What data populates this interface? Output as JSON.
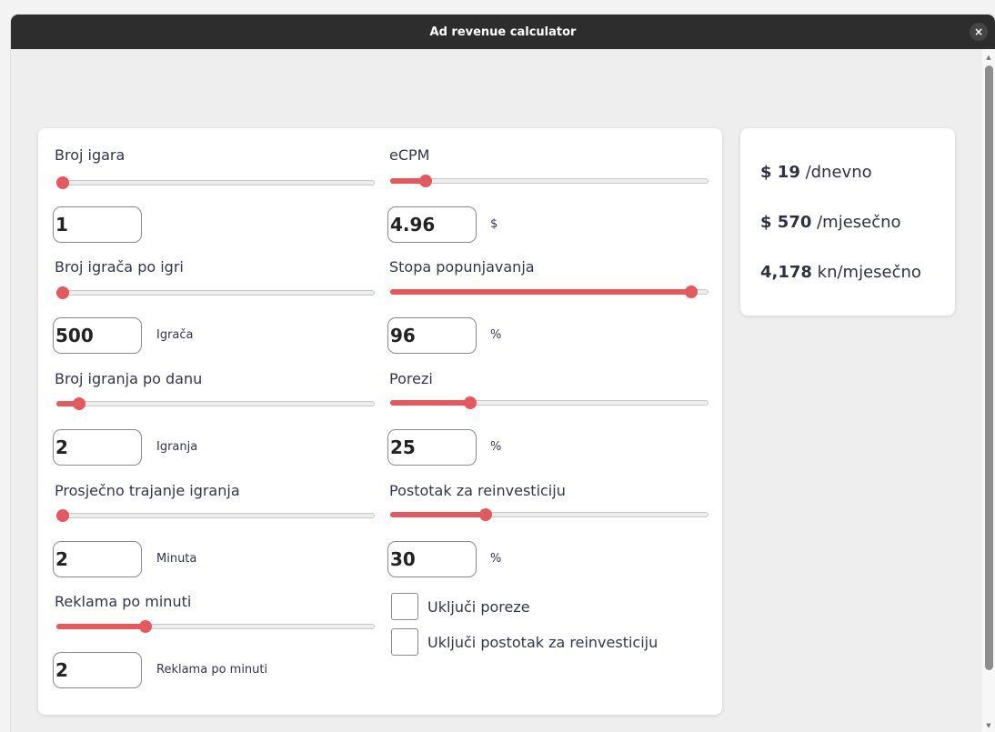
{
  "window": {
    "title": "Ad revenue calculator",
    "close_glyph": "×"
  },
  "fields": {
    "broj_igara": {
      "label": "Broj igara",
      "value": "1",
      "unit": "",
      "slider_fraction": 0.02
    },
    "broj_igraca": {
      "label": "Broj igrača po igri",
      "value": "500",
      "unit": "Igrača",
      "slider_fraction": 0.02
    },
    "broj_igranja": {
      "label": "Broj igranja po danu",
      "value": "2",
      "unit": "Igranja",
      "slider_fraction": 0.07
    },
    "trajanje": {
      "label": "Prosječno trajanje igranja",
      "value": "2",
      "unit": "Minuta",
      "slider_fraction": 0.02
    },
    "reklama": {
      "label": "Reklama po minuti",
      "value": "2",
      "unit": "Reklama po minuti",
      "slider_fraction": 0.28
    },
    "ecpm": {
      "label": "eCPM",
      "value": "4.96",
      "unit": "$",
      "slider_fraction": 0.11
    },
    "stopa": {
      "label": "Stopa popunjavanja",
      "value": "96",
      "unit": "%",
      "slider_fraction": 0.945
    },
    "porezi": {
      "label": "Porezi",
      "value": "25",
      "unit": "%",
      "slider_fraction": 0.25
    },
    "reinvest": {
      "label": "Postotak za reinvesticiju",
      "value": "30",
      "unit": "%",
      "slider_fraction": 0.3
    }
  },
  "checkboxes": {
    "porezi": {
      "label": "Uključi poreze",
      "checked": false
    },
    "reinvest": {
      "label": "Uključi postotak za reinvesticiju",
      "checked": false
    }
  },
  "results": {
    "daily": {
      "value": "$ 19",
      "suffix": " /dnevno"
    },
    "monthly_usd": {
      "value": "$ 570",
      "suffix": " /mjesečno"
    },
    "monthly_kn": {
      "value": "4,178",
      "suffix": " kn/mjesečno"
    }
  },
  "colors": {
    "accent": "#e5595e",
    "titlebar": "#2d2d2d",
    "text": "#33364a"
  }
}
